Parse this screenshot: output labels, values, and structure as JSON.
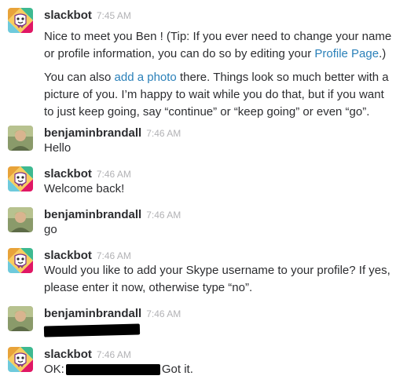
{
  "messages": [
    {
      "author": "slackbot",
      "time": "7:45 AM",
      "p1_text": "Nice to meet you Ben ! (Tip: If you ever need to change your name or profile information, you can do so by editing your ",
      "p1_link": "Profile Page",
      "p1_end": ".)",
      "p2_pre": "You can also ",
      "p2_link": "add a photo",
      "p2_post": " there. Things look so much better with a picture of you. I’m happy to wait while you do that, but if you want to just keep going, say “continue” or “keep going” or even “go”."
    },
    {
      "author": "benjaminbrandall",
      "time": "7:46 AM",
      "text": "Hello"
    },
    {
      "author": "slackbot",
      "time": "7:46 AM",
      "text": "Welcome back!"
    },
    {
      "author": "benjaminbrandall",
      "time": "7:46 AM",
      "text": "go"
    },
    {
      "author": "slackbot",
      "time": "7:46 AM",
      "text": "Would you like to add your Skype username to your profile?  If yes, please enter it now, otherwise type “no”."
    },
    {
      "author": "benjaminbrandall",
      "time": "7:46 AM",
      "text": ""
    },
    {
      "author": "slackbot",
      "time": "7:46 AM",
      "text_pre": "OK:",
      "text_post": "Got it."
    }
  ],
  "colors": {
    "link": "#2a80b9",
    "timestamp": "#b2b2b5",
    "author": "#2c2d30",
    "redaction": "#000000"
  },
  "icons": {
    "slackbot": "slackbot-avatar-icon",
    "user": "user-photo-avatar"
  }
}
